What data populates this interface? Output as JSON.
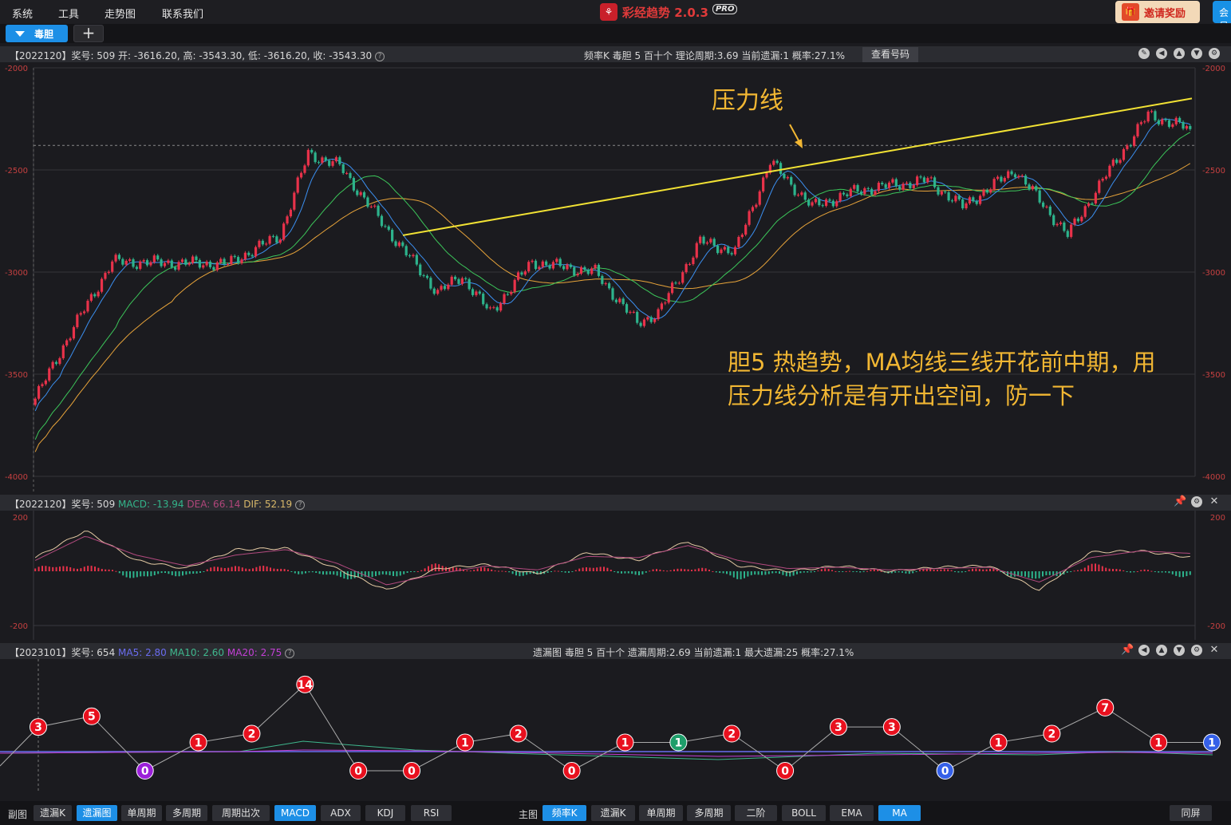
{
  "menu": [
    "系统",
    "工具",
    "走势图",
    "联系我们"
  ],
  "app": {
    "logo_glyph": "⚘",
    "name": "彩经趋势 2.0.3",
    "badge": "PRO"
  },
  "invite": {
    "icon": "gift-icon",
    "label": "邀请奖励"
  },
  "member_label": "会员",
  "tab": {
    "label": "毒胆",
    "add": "+"
  },
  "main_panel": {
    "info": "【2022120】奖号: 509   开: -3616.20, 高: -3543.30, 低: -3616.20, 收: -3543.30",
    "center": "频率K   毒胆   5   百十个   理论周期:3.69   当前遗漏:1   概率:27.1%",
    "query_button": "查看号码",
    "y_ticks": [
      "-2000",
      "-2500",
      "-3000",
      "-3500",
      "-4000"
    ],
    "annotation_resist": "压力线",
    "annotation_note_1": "胆5 热趋势，MA均线三线开花前中期，用",
    "annotation_note_2": "压力线分析是有开出空间，防一下"
  },
  "macd_panel": {
    "info_prefix": "【2022120】奖号: 509 ",
    "macd": "MACD: -13.94",
    "dea": "DEA: 66.14",
    "dif": "DIF: 52.19",
    "y_ticks": [
      "200",
      "-200"
    ]
  },
  "miss_panel": {
    "info_prefix": "【2023101】奖号: 654 ",
    "ma5": "MA5: 2.80",
    "ma10": "MA10: 2.60",
    "ma20": "MA20: 2.75",
    "center": "遗漏图   毒胆   5   百十个   遗漏周期:2.69   当前遗漏:1   最大遗漏:25   概率:27.1%"
  },
  "chart_data": [
    {
      "type": "candlestick",
      "title": "",
      "ylim": [
        -4000,
        -2000
      ],
      "y_ticks": [
        -2000,
        -2500,
        -3000,
        -3500,
        -4000
      ],
      "grid": true,
      "series_colors": {
        "up": "#e8324a",
        "down": "#2db38c",
        "ma_fast": "#3b8ff0",
        "ma_mid": "#3cc65a",
        "ma_slow": "#e8a43a",
        "resistance": "#f2e234"
      },
      "key_points": [
        {
          "i": 0,
          "close": -3620
        },
        {
          "i": 10,
          "close": -3300
        },
        {
          "i": 22,
          "close": -2950
        },
        {
          "i": 55,
          "close": -2960
        },
        {
          "i": 70,
          "close": -2820
        },
        {
          "i": 78,
          "close": -2420
        },
        {
          "i": 87,
          "close": -2480
        },
        {
          "i": 100,
          "close": -2780
        },
        {
          "i": 115,
          "close": -3100
        },
        {
          "i": 122,
          "close": -3020
        },
        {
          "i": 130,
          "close": -3200
        },
        {
          "i": 142,
          "close": -2950
        },
        {
          "i": 160,
          "close": -3000
        },
        {
          "i": 172,
          "close": -3250
        },
        {
          "i": 178,
          "close": -3200
        },
        {
          "i": 190,
          "close": -2850
        },
        {
          "i": 200,
          "close": -2900
        },
        {
          "i": 210,
          "close": -2460
        },
        {
          "i": 222,
          "close": -2680
        },
        {
          "i": 235,
          "close": -2600
        },
        {
          "i": 255,
          "close": -2550
        },
        {
          "i": 265,
          "close": -2680
        },
        {
          "i": 280,
          "close": -2500
        },
        {
          "i": 295,
          "close": -2820
        },
        {
          "i": 305,
          "close": -2550
        },
        {
          "i": 318,
          "close": -2230
        },
        {
          "i": 330,
          "close": -2300
        }
      ],
      "resistance_line": {
        "from": -2820,
        "to": -2150
      },
      "horizontal_dashed": -2380
    },
    {
      "type": "bar+line",
      "title": "MACD",
      "ylim": [
        -200,
        200
      ],
      "y_ticks": [
        200,
        -200
      ],
      "series": [
        {
          "name": "DIF",
          "values": [
            50,
            150,
            40,
            10,
            80,
            85,
            10,
            -70,
            10,
            25,
            -10,
            70,
            40,
            110,
            20,
            0,
            20,
            0,
            15,
            20,
            -70,
            70,
            75,
            52
          ]
        },
        {
          "name": "DEA",
          "values": [
            40,
            130,
            60,
            20,
            60,
            80,
            30,
            -50,
            -10,
            20,
            5,
            55,
            50,
            95,
            40,
            10,
            15,
            5,
            10,
            15,
            -40,
            50,
            75,
            66
          ]
        }
      ]
    },
    {
      "type": "line",
      "title": "遗漏图",
      "labels": [
        3,
        5,
        0,
        1,
        2,
        14,
        0,
        0,
        1,
        2,
        0,
        1,
        1,
        2,
        0,
        3,
        3,
        0,
        1,
        2,
        7,
        1,
        1
      ],
      "label_colors": [
        "red",
        "red",
        "purple",
        "red",
        "red",
        "red",
        "red",
        "red",
        "red",
        "red",
        "red",
        "red",
        "green",
        "red",
        "red",
        "red",
        "red",
        "blue",
        "red",
        "red",
        "red",
        "red",
        "blue"
      ],
      "series": [
        {
          "name": "MA5",
          "color": "#6a6cf0"
        },
        {
          "name": "MA10",
          "color": "#3fb88e"
        },
        {
          "name": "MA20",
          "color": "#c33fd6"
        }
      ]
    }
  ],
  "bottombar": {
    "sub_label": "副图",
    "sub_buttons": [
      "遗漏K",
      "遗漏图",
      "单周期",
      "多周期",
      "周期出次",
      "MACD",
      "ADX",
      "KDJ",
      "RSI"
    ],
    "main_label": "主图",
    "main_buttons": [
      "频率K",
      "遗漏K",
      "单周期",
      "多周期",
      "二阶",
      "BOLL",
      "EMA",
      "MA"
    ],
    "fullscreen": "同屏"
  }
}
